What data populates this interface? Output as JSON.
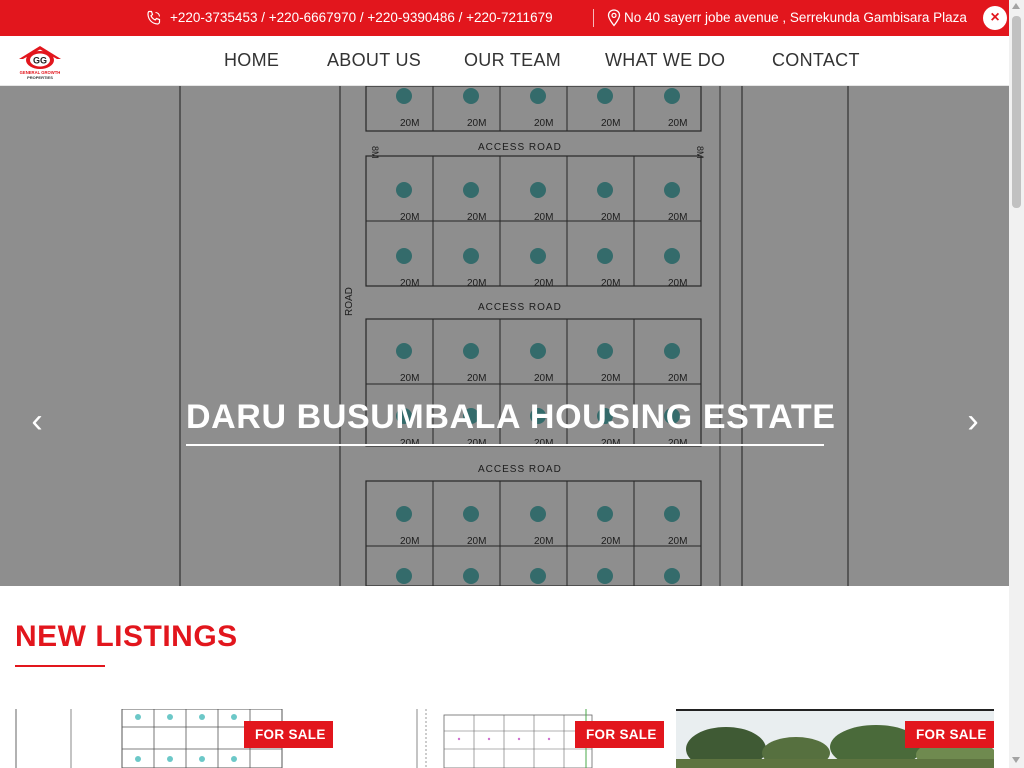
{
  "topbar": {
    "phones": "+220-3735453 / +220-6667970 / +220-9390486 / +220-7211679",
    "address": "No 40 sayerr jobe avenue , Serrekunda Gambisara Plaza",
    "close_label": "×"
  },
  "logo": {
    "initials": "GG",
    "line1": "GENERAL GROWTH",
    "line2": "PROPERTIES"
  },
  "nav": {
    "items": [
      "HOME",
      "ABOUT US",
      "OUR TEAM",
      "WHAT WE DO",
      "CONTACT"
    ]
  },
  "hero": {
    "title": "DARU BUSUMBALA HOUSING ESTATE",
    "prev_label": "‹",
    "next_label": "›",
    "plan": {
      "plot_label": "20M",
      "road_label": "ACCESS ROAD",
      "side_road_label": "ROAD",
      "road_width_label": "8M"
    }
  },
  "listings": {
    "title": "NEW LISTINGS",
    "cards": [
      {
        "badge": "FOR SALE"
      },
      {
        "badge": "FOR SALE"
      },
      {
        "badge": "FOR SALE"
      }
    ]
  },
  "colors": {
    "accent": "#e2161d",
    "plot_circle": "#5ab8b8"
  }
}
